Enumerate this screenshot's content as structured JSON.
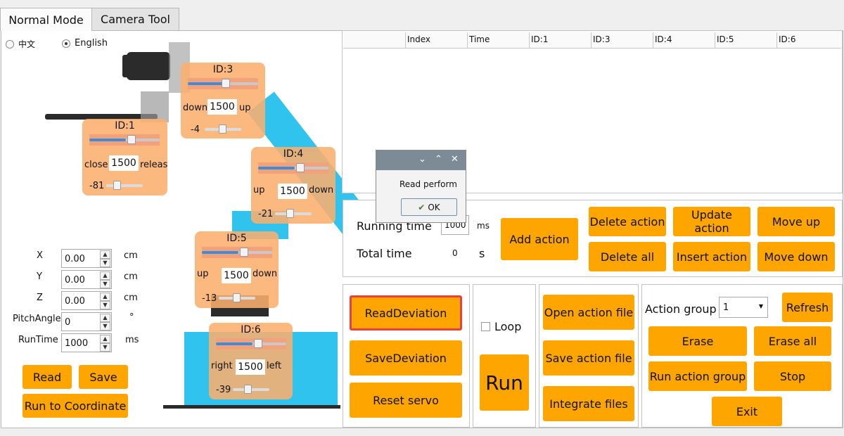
{
  "tabs": [
    "Normal Mode",
    "Camera Tool"
  ],
  "language": {
    "chinese": "中文",
    "english": "English",
    "selected": "English"
  },
  "servos": {
    "id3": {
      "title": "ID:3",
      "left": "down",
      "value": "1500",
      "right": "up",
      "dev": "-4"
    },
    "id1": {
      "title": "ID:1",
      "left": "close",
      "value": "1500",
      "right": "releas",
      "dev": "-81"
    },
    "id4": {
      "title": "ID:4",
      "left": "up",
      "value": "1500",
      "right": "down",
      "dev": "-21"
    },
    "id5": {
      "title": "ID:5",
      "left": "up",
      "value": "1500",
      "right": "down",
      "dev": "-13"
    },
    "id6": {
      "title": "ID:6",
      "left": "right",
      "value": "1500",
      "right": "left",
      "dev": "-39"
    }
  },
  "coords": [
    {
      "label": "X",
      "value": "0.00",
      "unit": "cm"
    },
    {
      "label": "Y",
      "value": "0.00",
      "unit": "cm"
    },
    {
      "label": "Z",
      "value": "0.00",
      "unit": "cm"
    },
    {
      "label": "PitchAngle",
      "value": "0",
      "unit": "°"
    },
    {
      "label": "RunTime",
      "value": "1000",
      "unit": "ms"
    }
  ],
  "left_buttons": {
    "read": "Read",
    "save": "Save",
    "run_coord": "Run to Coordinate"
  },
  "table_headers": [
    "",
    "Index",
    "Time",
    "ID:1",
    "ID:3",
    "ID:4",
    "ID:5",
    "ID:6"
  ],
  "timing": {
    "running_label": "Running time",
    "running_value": "1000",
    "running_unit": "ms",
    "total_label": "Total time",
    "total_value": "0",
    "total_unit": "s"
  },
  "action_buttons": {
    "add": "Add action",
    "delete": "Delete action",
    "update": "Update action",
    "move_up": "Move up",
    "delete_all": "Delete all",
    "insert": "Insert action",
    "move_down": "Move down"
  },
  "deviation": {
    "read": "ReadDeviation",
    "save": "SaveDeviation",
    "reset": "Reset servo"
  },
  "run": {
    "loop_label": "Loop",
    "run_label": "Run"
  },
  "files": {
    "open": "Open action file",
    "save": "Save action file",
    "integrate": "Integrate files"
  },
  "group": {
    "label": "Action group",
    "selected": "1",
    "refresh": "Refresh",
    "erase": "Erase",
    "erase_all": "Erase all",
    "run_group": "Run action group",
    "stop": "Stop",
    "exit": "Exit"
  },
  "dialog": {
    "message": "Read perform",
    "ok": "OK"
  },
  "colors": {
    "button": "#ffa500",
    "servo_panel": "#faaf6e",
    "robot_blue": "#2fc3ee",
    "highlight": "#e8413b"
  }
}
